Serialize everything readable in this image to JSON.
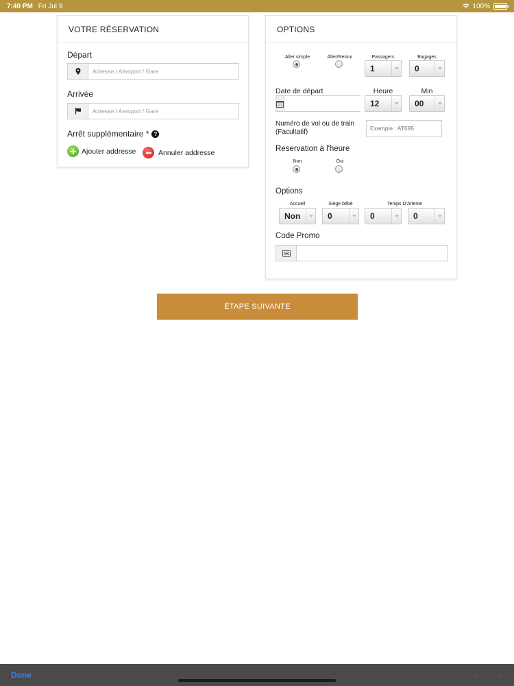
{
  "status_bar": {
    "time": "7:40 PM",
    "date": "Fri Jul 9",
    "battery": "100%"
  },
  "reservation": {
    "title": "VOTRE RÉSERVATION",
    "departure_label": "Départ",
    "departure_placeholder": "Adresse / Aéroport / Gare",
    "arrival_label": "Arrivée",
    "arrival_placeholder": "Adresse / Aeroport / Gare",
    "extra_stop_label": "Arrêt supplémentaire *",
    "add_address_label": "Ajouter addresse",
    "cancel_address_label": "Annuler addresse"
  },
  "options": {
    "title": "OPTIONS",
    "trip_one_way_label": "Aller simple",
    "trip_round_label": "Aller/Retour",
    "trip_selected": "Aller simple",
    "passengers_label": "Passagers",
    "passengers_value": "1",
    "bags_label": "Bagages",
    "bags_value": "0",
    "departure_date_label": "Date de départ",
    "hour_label": "Heure",
    "hour_value": "12",
    "min_label": "Min",
    "min_value": "00",
    "flight_label": "Numéro de vol ou de train (Facultatif)",
    "flight_placeholder": "Exemple : AT695",
    "hourly_label": "Reservation à l'heure",
    "hourly_no_label": "Non",
    "hourly_yes_label": "Oui",
    "hourly_selected": "Non",
    "options_label": "Options",
    "welcome_label": "Accueil",
    "welcome_value": "Non",
    "baby_seat_label": "Siège bébé",
    "baby_seat_value": "0",
    "wait_time_label": "Temps D'Attente",
    "wait_time_value_1": "0",
    "wait_time_value_2": "0",
    "promo_label": "Code Promo",
    "promo_value": ""
  },
  "next_step_label": "ÉTAPE SUIVANTE",
  "keyboard_bar": {
    "done_label": "Done"
  },
  "colors": {
    "status_bar": "#b5963f",
    "primary_button": "#c98c3a",
    "keyboard_bar": "#4a4a4a",
    "done_text": "#3d7fdc"
  }
}
